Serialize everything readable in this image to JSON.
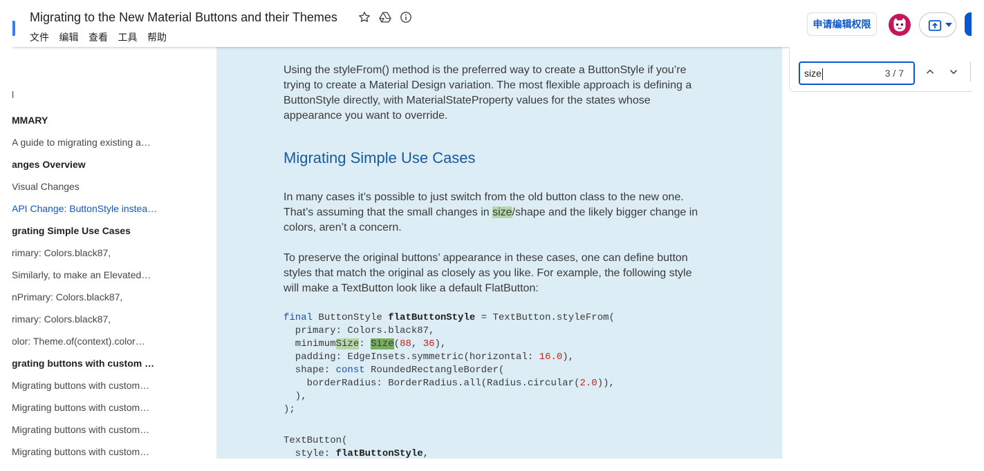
{
  "app": {
    "doc_title": "Migrating to the New Material Buttons and their Themes",
    "menu": [
      "文件",
      "编辑",
      "查看",
      "工具",
      "帮助"
    ],
    "request_edit_label": "申请编辑权限",
    "icons": {
      "logo": "docs-logo-icon",
      "star": "star-icon",
      "drive": "drive-shortcut-icon",
      "info": "info-icon",
      "present": "present-icon",
      "present_menu": "caret-down-icon"
    }
  },
  "find": {
    "query": "size",
    "count": "3 / 7",
    "icons": {
      "previous": "chevron-up-icon",
      "next": "chevron-down-icon"
    }
  },
  "outline": {
    "items": [
      {
        "text": "l"
      },
      {
        "text": "MMARY",
        "bold": true
      },
      {
        "text": "A guide to migrating existing a…"
      },
      {
        "text": "anges Overview",
        "bold": true
      },
      {
        "text": "Visual Changes"
      },
      {
        "text": "API Change: ButtonStyle instea…",
        "current": true
      },
      {
        "text": "grating Simple Use Cases",
        "bold": true
      },
      {
        "text": "rimary: Colors.black87,"
      },
      {
        "text": "Similarly, to make an Elevated…"
      },
      {
        "text": "nPrimary: Colors.black87,"
      },
      {
        "text": "rimary: Colors.black87,"
      },
      {
        "text": "olor: Theme.of(context).color…"
      },
      {
        "text": "grating buttons with custom …",
        "bold": true
      },
      {
        "text": "Migrating buttons with custom…"
      },
      {
        "text": "Migrating buttons with custom…"
      },
      {
        "text": "Migrating buttons with custom…"
      },
      {
        "text": "Migrating buttons with custom…"
      }
    ]
  },
  "doc": {
    "intro": [
      "Using the styleFrom() method is the preferred way to create a ButtonStyle if you’re",
      "trying to create a Material Design variation. The most flexible approach is defining a",
      "ButtonStyle directly, with MaterialStateProperty values for the states whose",
      "appearance you want to override."
    ],
    "heading": "Migrating Simple Use Cases",
    "para_cases": [
      "In many cases it’s possible to just switch from the old button class to the new one.",
      [
        {
          "t": "That’s assuming that the small changes in "
        },
        {
          "t": "size",
          "match": true
        },
        {
          "t": "/shape and the likely bigger change in"
        }
      ],
      "colors, aren’t a concern."
    ],
    "para_preserve": [
      "To preserve the original buttons’ appearance in these cases, one can define button",
      "styles that match the original as closely as you like. For example, the following style",
      "will make a TextButton look like a default FlatButton:"
    ],
    "code_style": [
      [
        {
          "t": "final",
          "keyword": true
        },
        {
          "t": " ButtonStyle "
        },
        {
          "t": "flatButtonStyle",
          "bold": true
        },
        {
          "t": " = TextButton.styleFrom("
        }
      ],
      "  primary: Colors.black87,",
      [
        {
          "t": "  minimum"
        },
        {
          "t": "Size",
          "match": true
        },
        {
          "t": ": "
        },
        {
          "t": "Size",
          "match": true,
          "current": true
        },
        {
          "t": "("
        },
        {
          "t": "88",
          "number": true
        },
        {
          "t": ", "
        },
        {
          "t": "36",
          "number": true
        },
        {
          "t": "),"
        }
      ],
      [
        {
          "t": "  padding: EdgeInsets.symmetric(horizontal: "
        },
        {
          "t": "16.0",
          "number": true
        },
        {
          "t": "),"
        }
      ],
      [
        {
          "t": "  shape: "
        },
        {
          "t": "const",
          "keyword": true
        },
        {
          "t": " RoundedRectangleBorder("
        }
      ],
      [
        {
          "t": "    borderRadius: BorderRadius.all(Radius.circular("
        },
        {
          "t": "2.0",
          "number": true
        },
        {
          "t": ")),"
        }
      ],
      "  ),",
      ");"
    ],
    "code_button": [
      "TextButton(",
      [
        {
          "t": "  style: "
        },
        {
          "t": "flatButtonStyle",
          "bold": true
        },
        {
          "t": ","
        }
      ]
    ]
  },
  "theme": {
    "accent": "#0b57d0",
    "logo": "#3b7cf0",
    "page": "#dcedf5",
    "heading": "#1a5a9c",
    "match": "#b5d6a7",
    "current_match": "#77ae60",
    "keyword": "#1b4fb3",
    "number": "#c5221f",
    "avatar": "#c2185b"
  }
}
